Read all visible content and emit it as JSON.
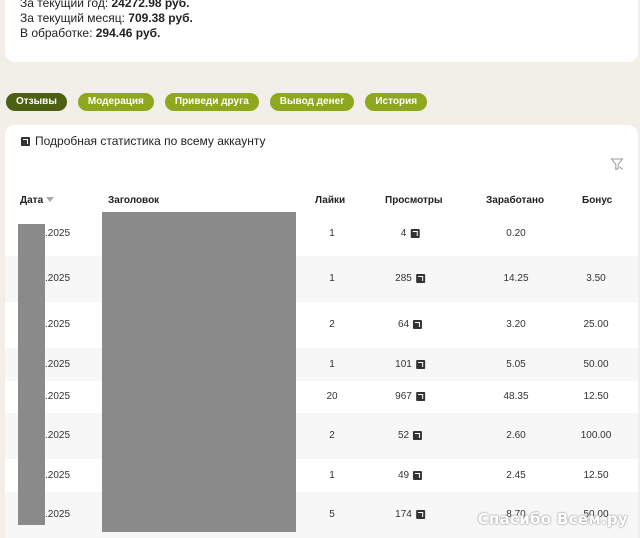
{
  "summary": {
    "year_label": "За текущий год:",
    "year_value": "24272.98 руб.",
    "month_label": "За текущий месяц:",
    "month_value": "709.38 руб.",
    "processing_label": "В обработке:",
    "processing_value": "294.46 руб."
  },
  "tabs": [
    {
      "label": "Отзывы",
      "active": true
    },
    {
      "label": "Модерация",
      "active": false
    },
    {
      "label": "Приведи друга",
      "active": false
    },
    {
      "label": "Вывод денег",
      "active": false
    },
    {
      "label": "История",
      "active": false
    }
  ],
  "stats": {
    "title": "Подробная статистика по всему аккаунту"
  },
  "table": {
    "headers": {
      "date": "Дата",
      "title": "Заголовок",
      "likes": "Лайки",
      "views": "Просмотры",
      "earned": "Заработано",
      "bonus": "Бонус"
    },
    "rows": [
      {
        "date": ".2025",
        "likes": "1",
        "views": "4",
        "earned": "0.20",
        "bonus": ""
      },
      {
        "date": ".2025",
        "likes": "1",
        "views": "285",
        "earned": "14.25",
        "bonus": "3.50"
      },
      {
        "date": ".2025",
        "likes": "2",
        "views": "64",
        "earned": "3.20",
        "bonus": "25.00"
      },
      {
        "date": ".2025",
        "likes": "1",
        "views": "101",
        "earned": "5.05",
        "bonus": "50.00"
      },
      {
        "date": ".2025",
        "likes": "20",
        "views": "967",
        "earned": "48.35",
        "bonus": "12.50"
      },
      {
        "date": ".2025",
        "likes": "2",
        "views": "52",
        "earned": "2.60",
        "bonus": "100.00"
      },
      {
        "date": ".2025",
        "likes": "1",
        "views": "49",
        "earned": "2.45",
        "bonus": "12.50"
      },
      {
        "date": ".2025",
        "likes": "5",
        "views": "174",
        "earned": "8.70",
        "bonus": "50.00"
      }
    ]
  },
  "watermark": "Спасибо Всем.ру"
}
